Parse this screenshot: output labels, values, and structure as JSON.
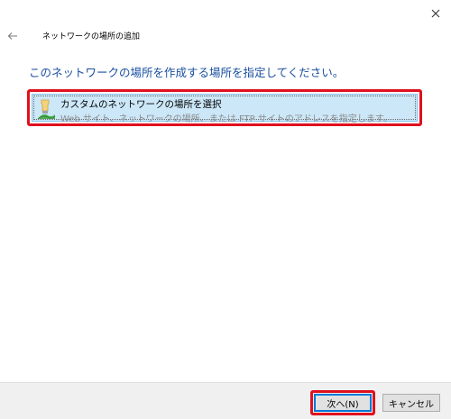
{
  "window": {
    "title": "ネットワークの場所の追加",
    "close_icon": "close-icon",
    "back_icon": "back-arrow-icon"
  },
  "main": {
    "instruction": "このネットワークの場所を作成する場所を指定してください。",
    "option": {
      "title": "カスタムのネットワークの場所を選択",
      "description": "Web サイト、ネットワークの場所、または FTP サイトのアドレスを指定します。",
      "icon": "network-location-icon",
      "selected": true
    }
  },
  "footer": {
    "next_label": "次へ(N)",
    "cancel_label": "キャンセル"
  },
  "colors": {
    "instruction_text": "#1a4fa0",
    "highlight_border": "#e0101e",
    "selection_background": "#cce7f8",
    "selection_border": "#86c3ea",
    "description_text": "#8b8b8b",
    "footer_background": "#f0f0f0",
    "default_button_border": "#0078d7"
  }
}
